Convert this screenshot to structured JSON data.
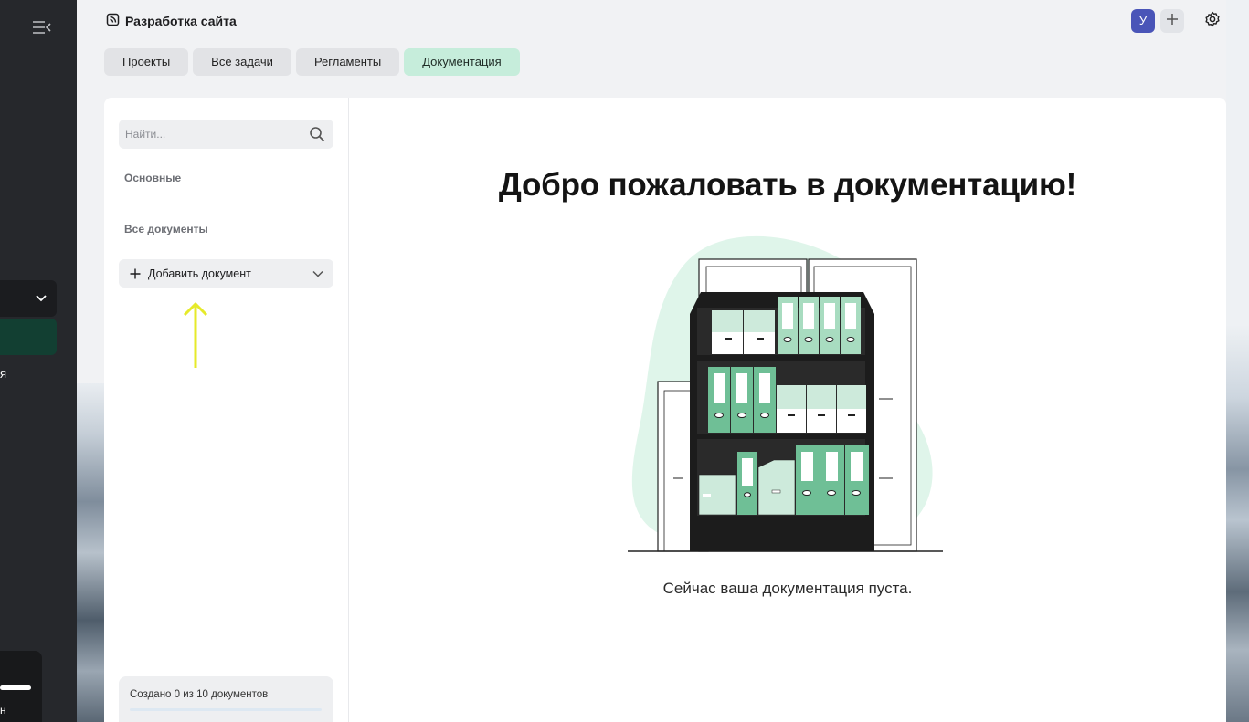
{
  "header": {
    "project_title": "Разработка сайта",
    "avatar_letter": "У"
  },
  "tabs": [
    {
      "label": "Проекты",
      "active": false
    },
    {
      "label": "Все задачи",
      "active": false
    },
    {
      "label": "Регламенты",
      "active": false
    },
    {
      "label": "Документация",
      "active": true
    }
  ],
  "sidebar": {
    "search_placeholder": "Найти...",
    "section_main": "Основные",
    "section_all": "Все документы",
    "add_document": "Добавить документ",
    "quota_text": "Создано 0 из 10 документов",
    "quota_used": 0,
    "quota_total": 10
  },
  "rail": {
    "cut_letter_1": "я",
    "cut_letter_2": "н"
  },
  "main": {
    "welcome_title": "Добро пожаловать в документацию!",
    "empty_message": "Сейчас ваша документация пуста."
  },
  "colors": {
    "active_tab": "#c6eddb",
    "avatar": "#4a55b8",
    "annotation_arrow": "#e6ea2a",
    "folder_green": "#6fbf96"
  },
  "icons": [
    "collapse-sidebar-icon",
    "project-icon",
    "plus-icon",
    "settings-icon",
    "search-icon",
    "chevron-down-icon"
  ]
}
